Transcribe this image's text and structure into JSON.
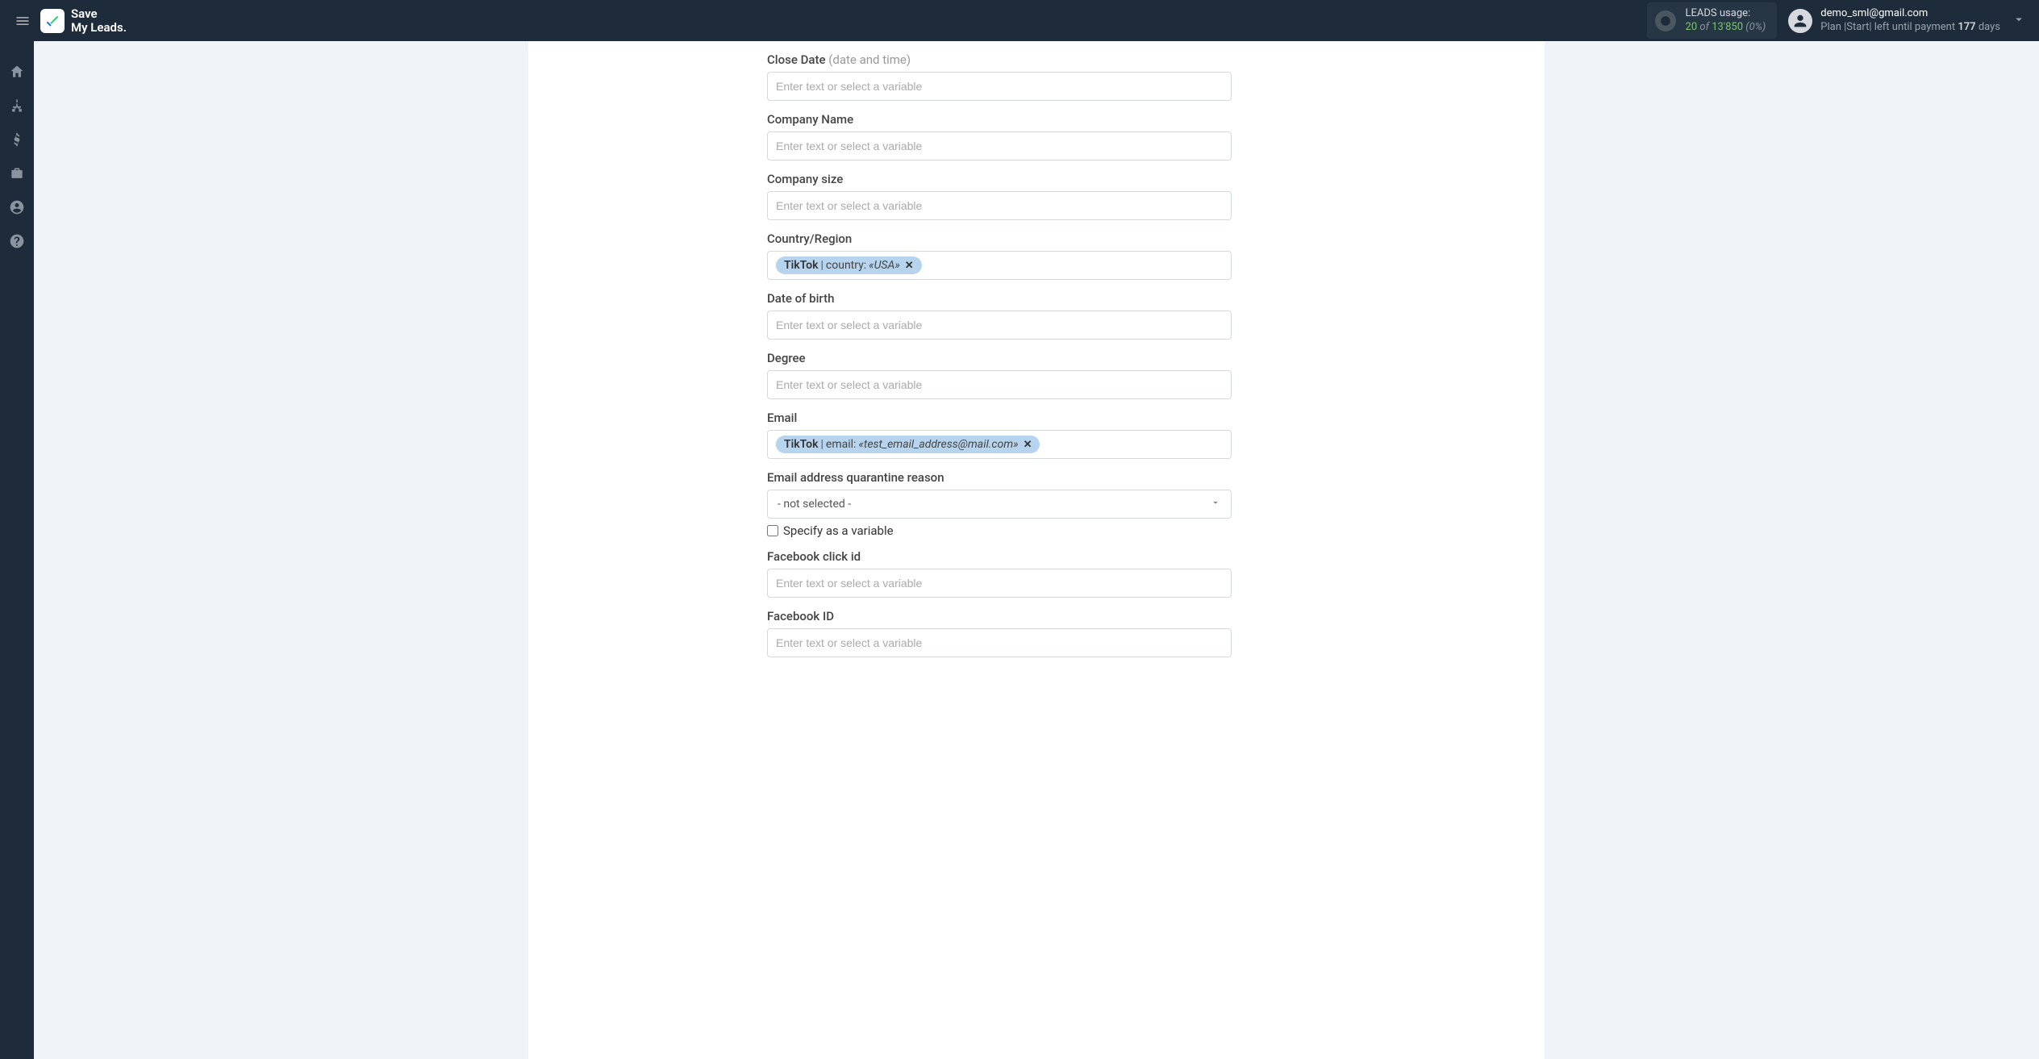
{
  "brand": {
    "line1": "Save",
    "line2": "My Leads."
  },
  "usage": {
    "label": "LEADS usage:",
    "current": "20",
    "of": "of",
    "total": "13'850",
    "pct": "(0%)"
  },
  "user": {
    "email": "demo_sml@gmail.com",
    "plan_prefix": "Plan |",
    "plan_name": "Start",
    "plan_mid": "| left until payment ",
    "days": "177",
    "plan_suffix": " days"
  },
  "form": {
    "placeholder": "Enter text or select a variable",
    "close_date": {
      "label": "Close Date",
      "hint": "(date and time)"
    },
    "company_name": {
      "label": "Company Name"
    },
    "company_size": {
      "label": "Company size"
    },
    "country": {
      "label": "Country/Region",
      "chip": {
        "source": "TikTok",
        "key": "country:",
        "value": "«USA»"
      }
    },
    "dob": {
      "label": "Date of birth"
    },
    "degree": {
      "label": "Degree"
    },
    "email": {
      "label": "Email",
      "chip": {
        "source": "TikTok",
        "key": "email:",
        "value": "«test_email_address@mail.com»"
      }
    },
    "quarantine": {
      "label": "Email address quarantine reason",
      "selected": "- not selected -",
      "specify": "Specify as a variable"
    },
    "fb_click_id": {
      "label": "Facebook click id"
    },
    "fb_id": {
      "label": "Facebook ID"
    }
  }
}
